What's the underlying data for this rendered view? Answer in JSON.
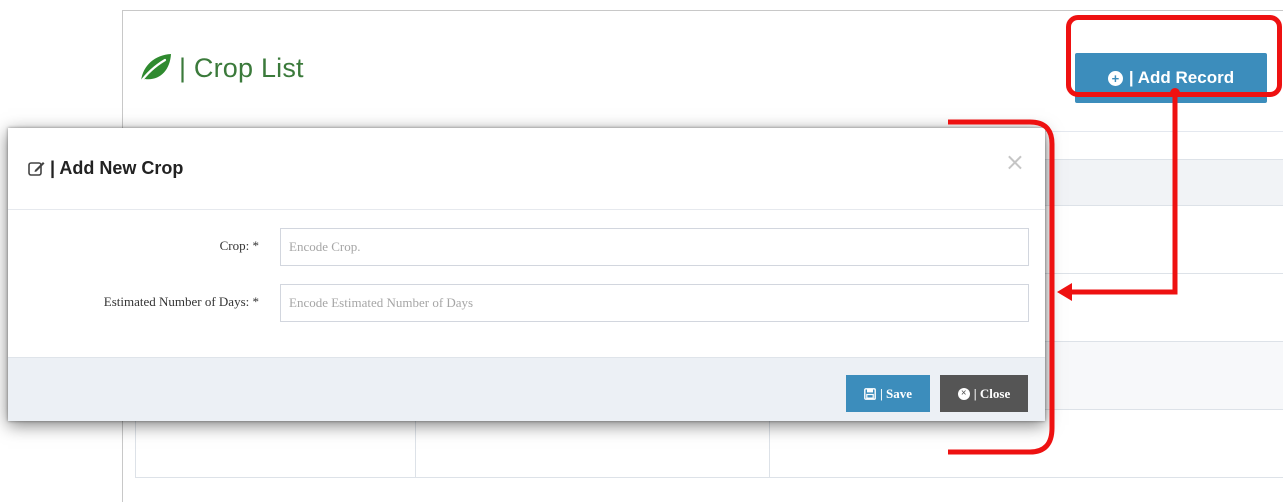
{
  "page": {
    "title": "| Crop List",
    "add_record_label": "| Add Record"
  },
  "modal": {
    "title": "| Add New Crop",
    "close_symbol": "×",
    "fields": [
      {
        "label": "Crop: *",
        "placeholder": "Encode Crop.",
        "value": ""
      },
      {
        "label": "Estimated Number of Days: *",
        "placeholder": "Encode Estimated Number of Days",
        "value": ""
      }
    ],
    "save_label": "| Save",
    "close_label": "| Close"
  },
  "icons": {
    "title": "leaf-icon",
    "add_record": "circle-plus-icon",
    "modal_title": "edit-icon",
    "save": "floppy-disk-icon",
    "close": "circle-x-icon"
  },
  "colors": {
    "primary": "#3c8dbc",
    "dark": "#555555",
    "title_green": "#3b7a3b",
    "annotation_red": "#ee1111"
  }
}
